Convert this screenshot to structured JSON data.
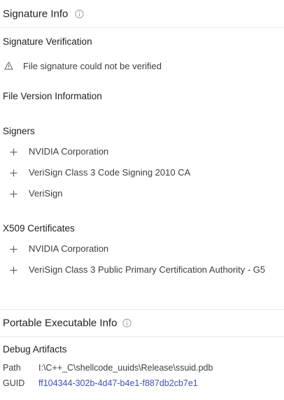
{
  "signature_info": {
    "title": "Signature Info",
    "info_icon": "info-icon",
    "verification": {
      "heading": "Signature Verification",
      "status_icon": "warning-icon",
      "status_text": "File signature could not be verified"
    },
    "file_version": {
      "heading": "File Version Information"
    },
    "signers": {
      "heading": "Signers",
      "items": [
        {
          "label": "NVIDIA Corporation",
          "icon": "plus-icon"
        },
        {
          "label": "VeriSign Class 3 Code Signing 2010 CA",
          "icon": "plus-icon"
        },
        {
          "label": "VeriSign",
          "icon": "plus-icon"
        }
      ]
    },
    "x509": {
      "heading": "X509 Certificates",
      "items": [
        {
          "label": "NVIDIA Corporation",
          "icon": "plus-icon"
        },
        {
          "label": "VeriSign Class 3 Public Primary Certification Authority - G5",
          "icon": "plus-icon"
        }
      ]
    }
  },
  "portable_executable": {
    "title": "Portable Executable Info",
    "info_icon": "info-icon",
    "debug_artifacts": {
      "heading": "Debug Artifacts",
      "path_key": "Path",
      "path_value": "I:\\C++_C\\shellcode_uuids\\Release\\ssuid.pdb",
      "guid_key": "GUID",
      "guid_value": "ff104344-302b-4d47-b4e1-f887db2cb7e1"
    }
  },
  "colors": {
    "link": "#3f51b5",
    "icon_gray": "#9aa0a6",
    "divider": "#e8eaed"
  }
}
